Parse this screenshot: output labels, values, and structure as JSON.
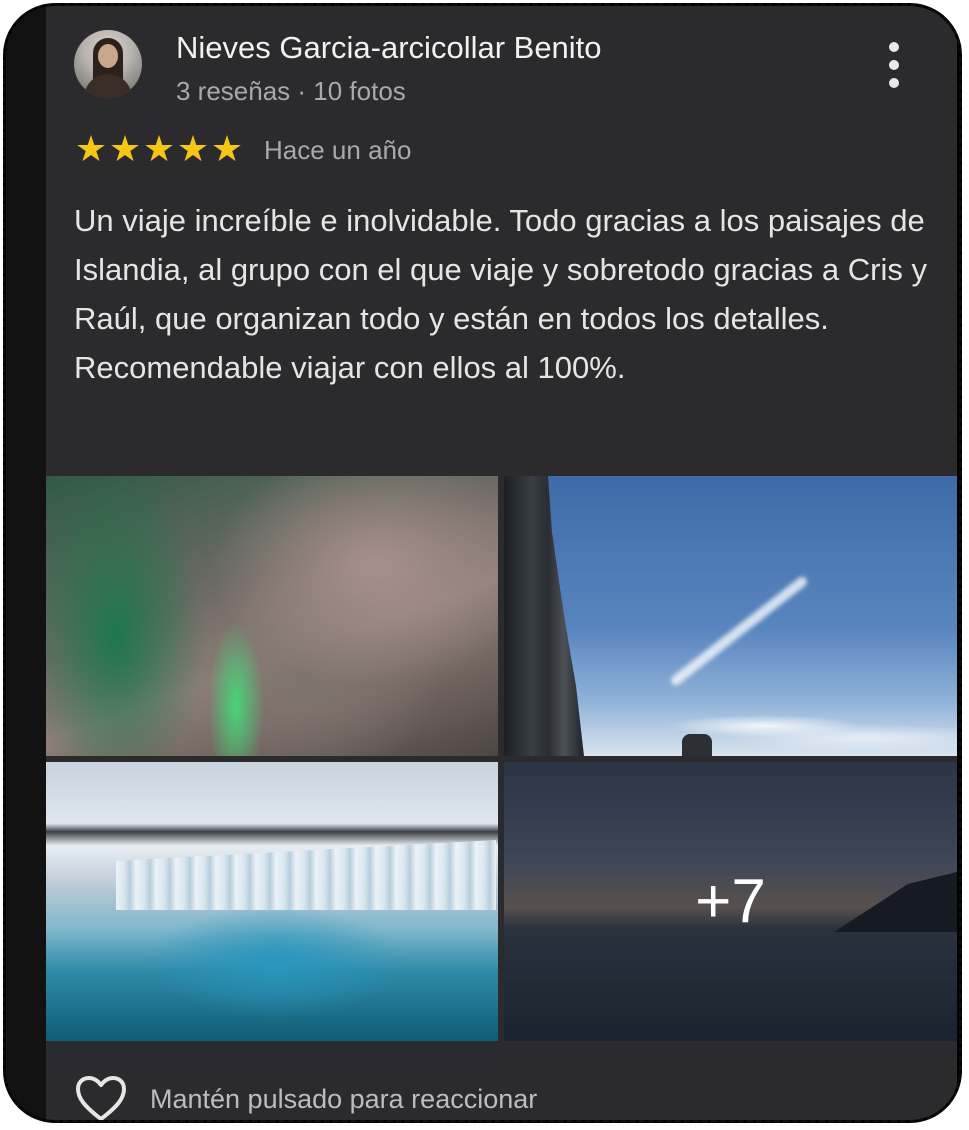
{
  "review": {
    "author": "Nieves Garcia-arcicollar Benito",
    "author_meta": "3 reseñas · 10 fotos",
    "rating": 5,
    "stars": [
      "★",
      "★",
      "★",
      "★",
      "★"
    ],
    "date": "Hace un año",
    "text": "Un viaje increíble e inolvidable. Todo gracias a los paisajes de Islandia, al grupo con el que viaje y sobretodo gracias a Cris y Raúl, que organizan todo y están en todos los detalles. Recomendable viajar con ellos al 100%.",
    "more_photos_label": "+7",
    "react_hint": "Mantén pulsado para reaccionar"
  },
  "colors": {
    "card_bg": "#2b2b2d",
    "star": "#f5c518",
    "text_primary": "#f1f1f1",
    "text_secondary": "#a9a9ab"
  },
  "icons": {
    "menu": "kebab-vertical-icon",
    "react": "heart-outline-icon"
  }
}
